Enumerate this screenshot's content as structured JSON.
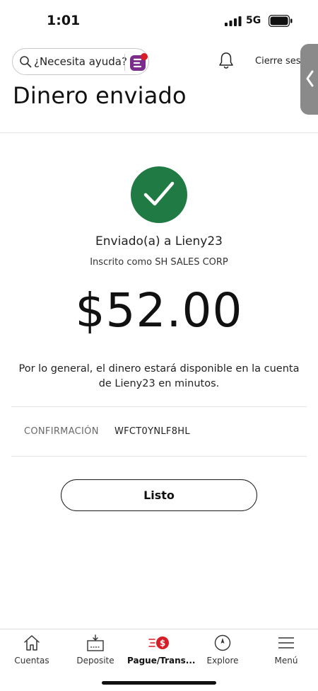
{
  "status_bar": {
    "time": "1:01",
    "network": "5G",
    "icons": [
      "signal-bars-icon",
      "battery-icon"
    ]
  },
  "header": {
    "search_placeholder": "¿Necesita ayuda?",
    "logout_label": "Cierre sesió",
    "page_title": "Dinero enviado",
    "icons": [
      "search-icon",
      "assistant-icon",
      "bell-icon"
    ]
  },
  "receipt": {
    "recipient_line": "Enviado(a) a Lieny23",
    "enrolled_line": "Inscrito como SH SALES CORP",
    "amount": "$52.00",
    "availability_note": "Por lo general, el dinero estará disponible en la cuenta de Lieny23 en minutos.",
    "confirmation_label": "CONFIRMACIÓN",
    "confirmation_value": "WFCT0YNLF8HL",
    "done_label": "Listo"
  },
  "tabs": [
    {
      "label": "Cuentas",
      "icon": "home-icon",
      "active": false
    },
    {
      "label": "Deposite",
      "icon": "check-deposit-icon",
      "active": false
    },
    {
      "label": "Pague/Trans...",
      "icon": "pay-transfer-icon",
      "active": true
    },
    {
      "label": "Explore",
      "icon": "compass-icon",
      "active": false
    },
    {
      "label": "Menú",
      "icon": "hamburger-menu-icon",
      "active": false
    }
  ],
  "colors": {
    "success_green": "#1f7a43",
    "brand_red": "#d71e28",
    "brand_purple": "#7b2d8e",
    "side_handle_gray": "#8a8a8a"
  }
}
